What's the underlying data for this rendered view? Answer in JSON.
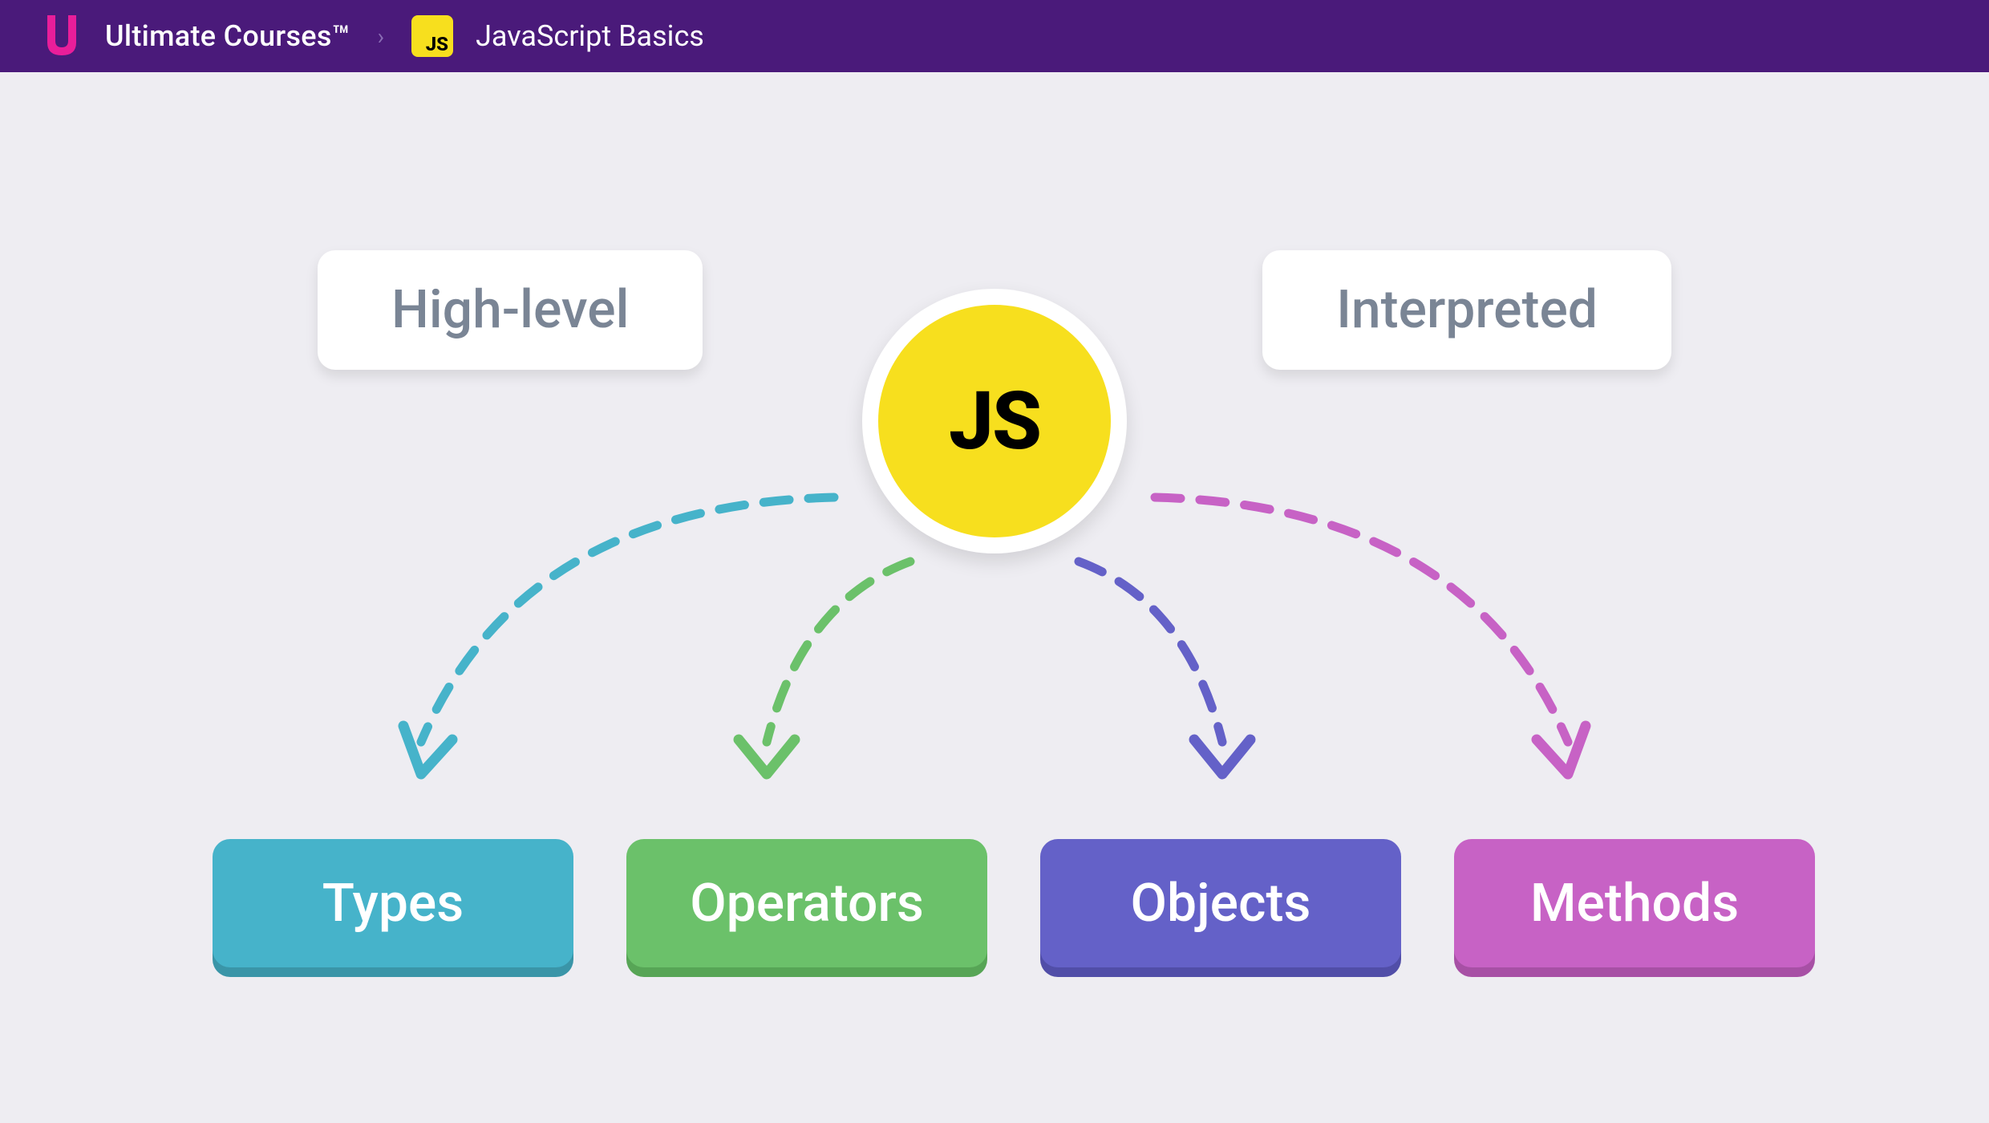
{
  "header": {
    "brand": "Ultimate Courses™",
    "js_badge": "JS",
    "course_title": "JavaScript Basics"
  },
  "diagram": {
    "top_left_label": "High-level",
    "top_right_label": "Interpreted",
    "center_label": "JS",
    "bottom_labels": {
      "types": "Types",
      "operators": "Operators",
      "objects": "Objects",
      "methods": "Methods"
    },
    "colors": {
      "header_bg": "#4a1a7a",
      "js_yellow": "#f7df1e",
      "types": "#46b3ca",
      "operators": "#6bc16a",
      "objects": "#6461c8",
      "methods": "#c762c5"
    }
  }
}
